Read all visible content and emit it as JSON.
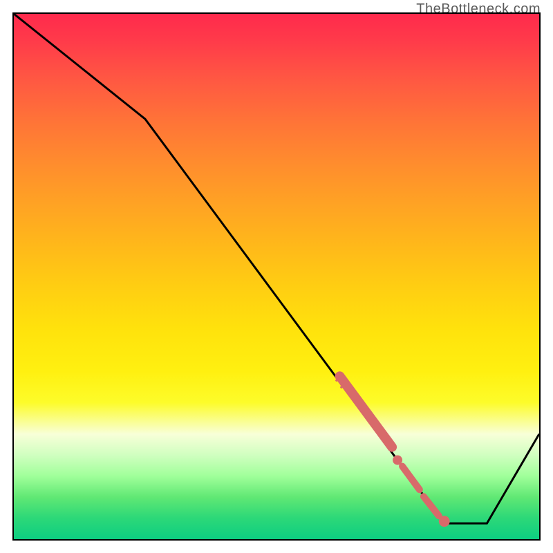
{
  "watermark": "TheBottleneck.com",
  "chart_data": {
    "type": "line",
    "title": "",
    "xlabel": "",
    "ylabel": "",
    "xlim": [
      0,
      100
    ],
    "ylim": [
      0,
      100
    ],
    "line": {
      "x": [
        0,
        25,
        82,
        90,
        100
      ],
      "y": [
        100,
        80,
        3,
        3,
        20
      ],
      "color": "#000000"
    },
    "highlighted_segments": [
      {
        "x_start": 62,
        "y_start": 31,
        "x_end": 72,
        "y_end": 16,
        "thickness": "thick",
        "color": "#d86a6a"
      },
      {
        "x_start": 74,
        "y_start": 14,
        "x_end": 76,
        "y_end": 11,
        "thickness": "medium",
        "color": "#d86a6a"
      },
      {
        "x_start": 77,
        "y_start": 10,
        "x_end": 82,
        "y_end": 4,
        "thickness": "medium",
        "color": "#d86a6a"
      }
    ],
    "highlight_dots": [
      {
        "x": 73,
        "y": 15,
        "r": 4,
        "color": "#d86a6a"
      },
      {
        "x": 82,
        "y": 3.5,
        "r": 5,
        "color": "#d86a6a"
      }
    ],
    "gradient_stops": [
      {
        "offset": 0,
        "color": "#ff2a4c"
      },
      {
        "offset": 80,
        "color": "#fff010"
      },
      {
        "offset": 100,
        "color": "#0dce82"
      }
    ]
  }
}
